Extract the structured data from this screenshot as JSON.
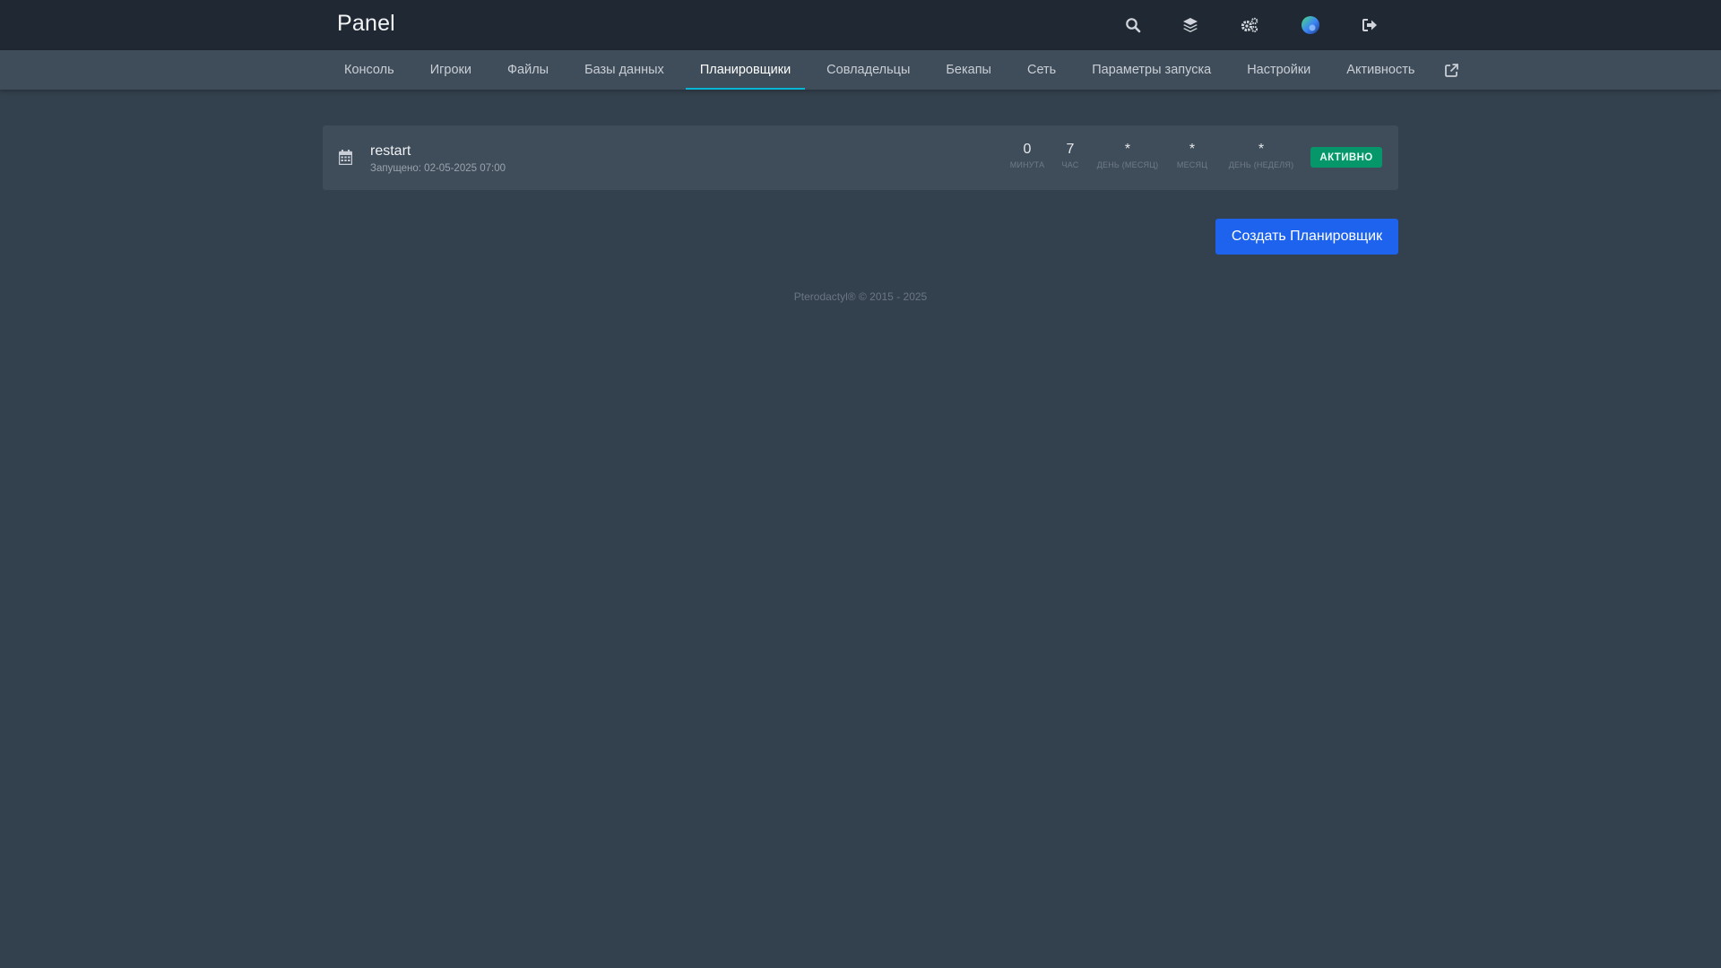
{
  "header": {
    "brand": "Panel",
    "icons": [
      "search-icon",
      "layers-icon",
      "cogs-icon",
      "avatar",
      "sign-out-icon"
    ]
  },
  "tabs": [
    {
      "label": "Консоль",
      "active": false
    },
    {
      "label": "Игроки",
      "active": false
    },
    {
      "label": "Файлы",
      "active": false
    },
    {
      "label": "Базы данных",
      "active": false
    },
    {
      "label": "Планировщики",
      "active": true
    },
    {
      "label": "Совладельцы",
      "active": false
    },
    {
      "label": "Бекапы",
      "active": false
    },
    {
      "label": "Сеть",
      "active": false
    },
    {
      "label": "Параметры запуска",
      "active": false
    },
    {
      "label": "Настройки",
      "active": false
    },
    {
      "label": "Активность",
      "active": false
    }
  ],
  "schedule": {
    "name": "restart",
    "last_run": "Запущено: 02-05-2025 07:00",
    "cron": [
      {
        "value": "0",
        "label": "Минута"
      },
      {
        "value": "7",
        "label": "Час"
      },
      {
        "value": "*",
        "label": "День (месяц)"
      },
      {
        "value": "*",
        "label": "Месяц"
      },
      {
        "value": "*",
        "label": "День (неделя)"
      }
    ],
    "status": "АКТИВНО"
  },
  "actions": {
    "create_label": "Создать Планировщик"
  },
  "footer": {
    "text": "Pterodactyl® © 2015 - 2025"
  },
  "colors": {
    "background": "#33404d",
    "topbar": "#1f2833",
    "subnav": "#3f4d5a",
    "tab_active_underline": "#06b6d4",
    "status_active": "#059669",
    "primary_button": "#1d63ed"
  }
}
